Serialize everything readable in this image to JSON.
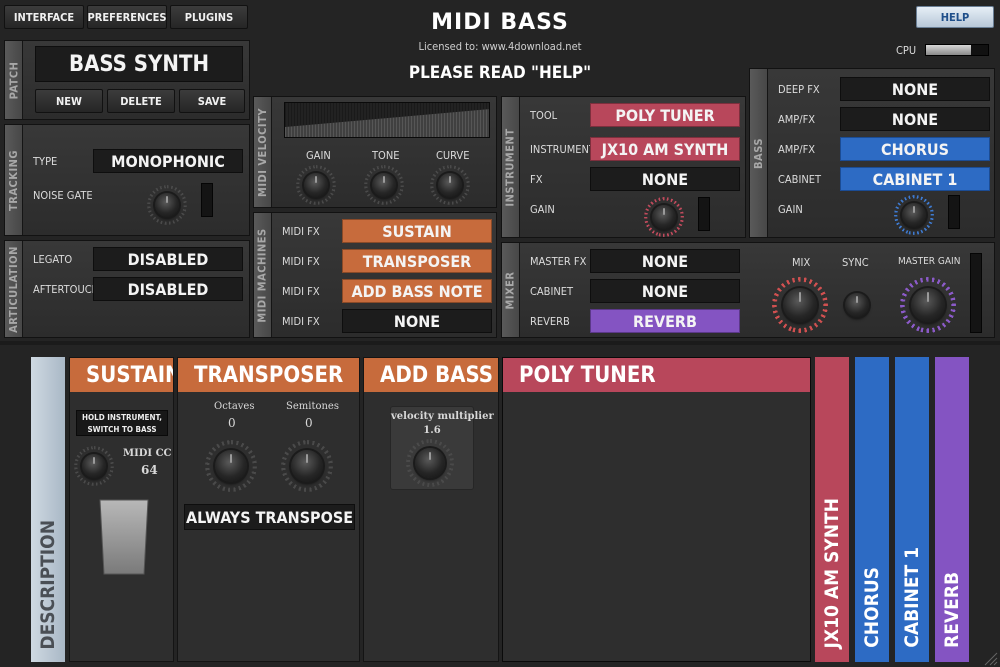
{
  "top_menu": {
    "interface": "INTERFACE",
    "preferences": "PREFERENCES",
    "plugins": "PLUGINS",
    "help": "HELP"
  },
  "header": {
    "title": "MIDI BASS",
    "license": "Licensed to: www.4download.net",
    "notice": "PLEASE READ \"HELP\"",
    "cpu_label": "CPU",
    "cpu_level": 0.72
  },
  "patch": {
    "tab": "PATCH",
    "name": "BASS SYNTH",
    "new": "NEW",
    "delete": "DELETE",
    "save": "SAVE"
  },
  "tracking": {
    "tab": "TRACKING",
    "type_label": "TYPE",
    "type_value": "MONOPHONIC",
    "noise_gate_label": "NOISE GATE"
  },
  "articulation": {
    "tab": "ARTICULATION",
    "legato_label": "LEGATO",
    "legato_value": "DISABLED",
    "aftertouch_label": "AFTERTOUCH",
    "aftertouch_value": "DISABLED"
  },
  "midi_velocity": {
    "tab": "MIDI VELOCITY",
    "gain": "GAIN",
    "tone": "TONE",
    "curve": "CURVE"
  },
  "midi_machines": {
    "tab": "MIDI MACHINES",
    "slots": [
      {
        "label": "MIDI FX",
        "value": "SUSTAIN",
        "color": "#c76b3c"
      },
      {
        "label": "MIDI FX",
        "value": "TRANSPOSER",
        "color": "#c76b3c"
      },
      {
        "label": "MIDI FX",
        "value": "ADD BASS NOTE",
        "color": "#c76b3c"
      },
      {
        "label": "MIDI FX",
        "value": "NONE",
        "color": "#1c1c1c"
      }
    ]
  },
  "instrument": {
    "tab": "INSTRUMENT",
    "tool_label": "TOOL",
    "tool_value": "POLY TUNER",
    "instrument_label": "INSTRUMENT",
    "instrument_value": "JX10 AM SYNTH",
    "fx_label": "FX",
    "fx_value": "NONE",
    "gain_label": "GAIN"
  },
  "bass": {
    "tab": "BASS",
    "deep_fx_label": "DEEP FX",
    "deep_fx_value": "NONE",
    "ampfx1_label": "AMP/FX",
    "ampfx1_value": "NONE",
    "ampfx2_label": "AMP/FX",
    "ampfx2_value": "CHORUS",
    "cabinet_label": "CABINET",
    "cabinet_value": "CABINET 1",
    "gain_label": "GAIN"
  },
  "mixer": {
    "tab": "MIXER",
    "master_fx_label": "MASTER FX",
    "master_fx_value": "NONE",
    "cabinet_label": "CABINET",
    "cabinet_value": "NONE",
    "reverb_label": "REVERB",
    "reverb_value": "REVERB",
    "mix": "MIX",
    "sync": "SYNC",
    "master_gain": "MASTER GAIN"
  },
  "description_tab": "DESCRIPTION",
  "sustain": {
    "title": "SUSTAIN",
    "instruction": "HOLD INSTRUMENT, SWITCH TO BASS",
    "midi_cc_label": "MIDI CC",
    "midi_cc_value": "64"
  },
  "transposer": {
    "title": "TRANSPOSER",
    "octaves_label": "Octaves",
    "octaves_value": "0",
    "semitones_label": "Semitones",
    "semitones_value": "0",
    "always": "ALWAYS TRANSPOSE"
  },
  "add_bass": {
    "title": "ADD BASS ...",
    "vel_label": "velocity multiplier",
    "vel_value": "1.6"
  },
  "poly_tuner": {
    "title": "POLY TUNER"
  },
  "strips": [
    {
      "label": "JX10 AM SYNTH",
      "color": "#b8475b"
    },
    {
      "label": "CHORUS",
      "color": "#2d6bc4"
    },
    {
      "label": "CABINET 1",
      "color": "#2d6bc4"
    },
    {
      "label": "REVERB",
      "color": "#8454c2"
    }
  ]
}
